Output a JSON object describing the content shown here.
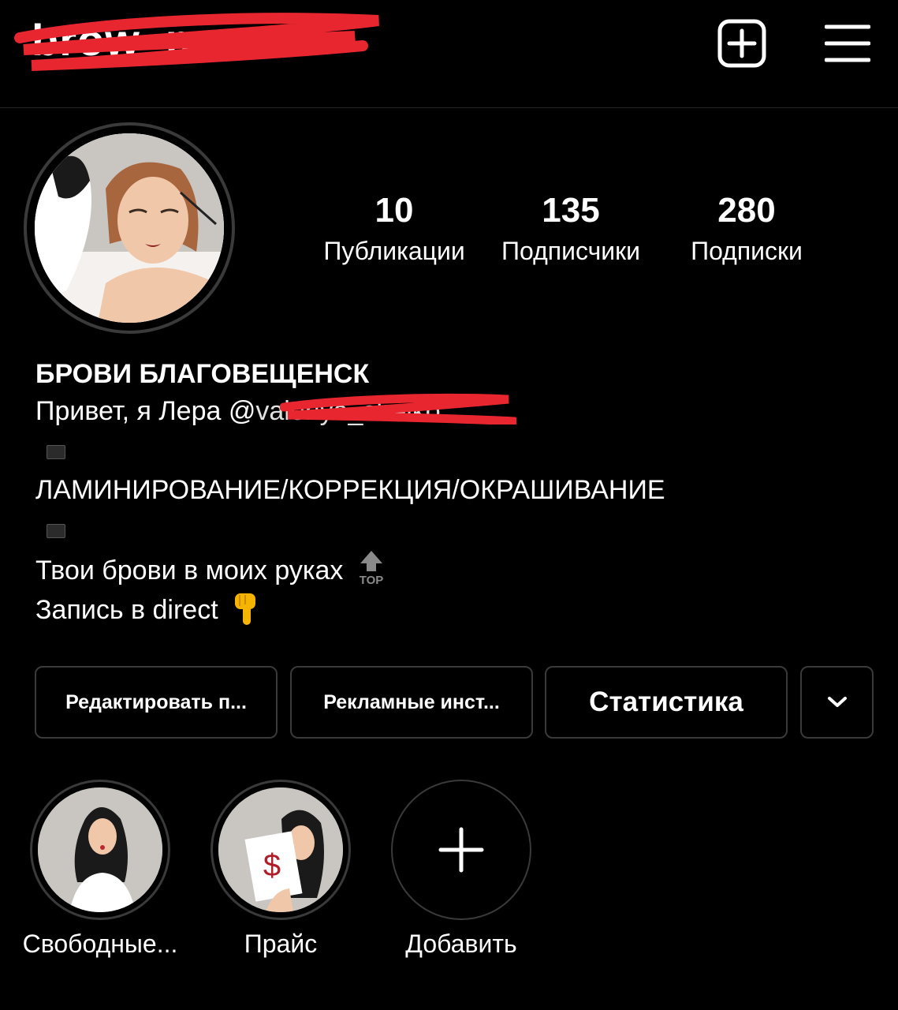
{
  "header": {
    "username": "brow_master",
    "new_post_icon": "plus-square-icon",
    "menu_icon": "hamburger-menu-icon"
  },
  "stats": [
    {
      "count": "10",
      "label": "Публикации"
    },
    {
      "count": "135",
      "label": "Подписчики"
    },
    {
      "count": "280",
      "label": "Подписки"
    }
  ],
  "bio": {
    "name": "БРОВИ БЛАГОВЕЩЕНСК",
    "greeting": "Привет, я Лера @",
    "mention": "valeriya_sheiko",
    "services": "ЛАМИНИРОВАНИЕ/КОРРЕКЦИЯ/ОКРАШИВАНИЕ",
    "tagline": "Твои брови в моих руках",
    "tagline_emoji": "top-arrow-icon",
    "booking": "Запись в direct",
    "booking_emoji": "pointing-down-hand-icon"
  },
  "buttons": {
    "edit": "Редактировать п...",
    "ads": "Рекламные инст...",
    "stats": "Статистика"
  },
  "highlights": [
    {
      "label": "Свободные..."
    },
    {
      "label": "Прайс"
    },
    {
      "label": "Добавить"
    }
  ],
  "colors": {
    "background": "#000000",
    "text": "#ffffff",
    "border": "#3a3a3a",
    "redaction": "#e8262f"
  }
}
